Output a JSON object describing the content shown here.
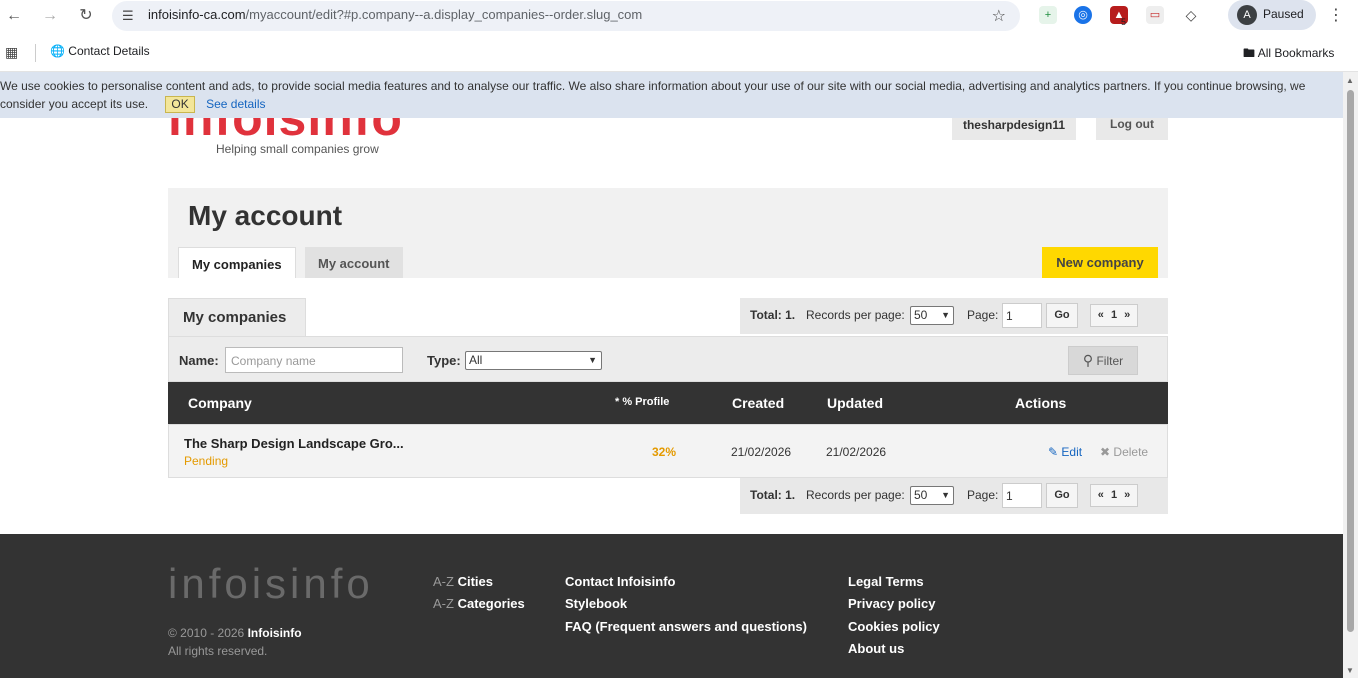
{
  "browser": {
    "url_host": "infoisinfo-ca.com",
    "url_path": "/myaccount/edit?#p.company--a.display_companies--order.slug_com",
    "profile_initial": "A",
    "profile_status": "Paused",
    "extension_badge": "5",
    "bookmark_item": "Contact Details",
    "bookmarks_all": "All Bookmarks"
  },
  "cookie": {
    "text": "We use cookies to personalise content and ads, to provide social media features and to analyse our traffic. We also share information about your use of our site with our social media, advertising and analytics partners. If you continue browsing, we consider you accept its use.",
    "ok": "OK",
    "details": "See details"
  },
  "header": {
    "logo": "infoisinfo",
    "tagline": "Helping small companies grow",
    "username": "thesharpdesign11",
    "logout": "Log out"
  },
  "account": {
    "title": "My account",
    "tabs": [
      "My companies",
      "My account"
    ],
    "new_company": "New company"
  },
  "companies": {
    "section_title": "My companies",
    "pager": {
      "total": "Total: 1.",
      "rpp_label": "Records per page:",
      "rpp_value": "50",
      "page_label": "Page:",
      "page_value": "1",
      "go": "Go",
      "pages": "« 1 »"
    },
    "filter": {
      "name_label": "Name:",
      "name_placeholder": "Company name",
      "type_label": "Type:",
      "type_value": "All",
      "button": "Filter"
    },
    "columns": {
      "company": "Company",
      "profile": "* % Profile",
      "created": "Created",
      "updated": "Updated",
      "actions": "Actions"
    },
    "rows": [
      {
        "name": "The Sharp Design Landscape Gro...",
        "status": "Pending",
        "profile": "32%",
        "created": "21/02/2026",
        "updated": "21/02/2026",
        "edit": "Edit",
        "delete": "Delete"
      }
    ]
  },
  "footer": {
    "logo": "infoisinfo",
    "copyright_prefix": "© 2010 - 2026",
    "copyright_brand": "Infoisinfo",
    "rights": "All rights reserved.",
    "az_prefix": "A-Z",
    "cities": "Cities",
    "categories": "Categories",
    "contact": "Contact Infoisinfo",
    "stylebook": "Stylebook",
    "faq": "FAQ (Frequent answers and questions)",
    "legal": "Legal Terms",
    "privacy": "Privacy policy",
    "cookies": "Cookies policy",
    "about": "About us"
  }
}
